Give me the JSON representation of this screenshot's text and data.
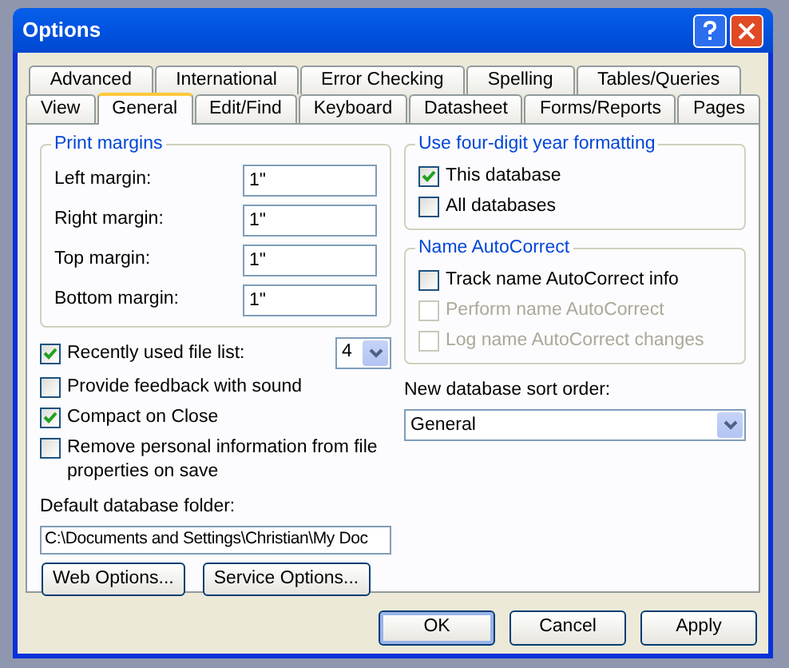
{
  "window": {
    "title": "Options"
  },
  "tab_rows": [
    [
      {
        "label": "Advanced",
        "selected": false
      },
      {
        "label": "International",
        "selected": false
      },
      {
        "label": "Error Checking",
        "selected": false
      },
      {
        "label": "Spelling",
        "selected": false
      },
      {
        "label": "Tables/Queries",
        "selected": false
      }
    ],
    [
      {
        "label": "View",
        "selected": false
      },
      {
        "label": "General",
        "selected": true
      },
      {
        "label": "Edit/Find",
        "selected": false
      },
      {
        "label": "Keyboard",
        "selected": false
      },
      {
        "label": "Datasheet",
        "selected": false
      },
      {
        "label": "Forms/Reports",
        "selected": false
      },
      {
        "label": "Pages",
        "selected": false
      }
    ]
  ],
  "print_margins": {
    "title": "Print margins",
    "fields": [
      {
        "label": "Left margin:",
        "value": "1\""
      },
      {
        "label": "Right margin:",
        "value": "1\""
      },
      {
        "label": "Top margin:",
        "value": "1\""
      },
      {
        "label": "Bottom margin:",
        "value": "1\""
      }
    ]
  },
  "options": [
    {
      "kind": "dropdown",
      "label": "Recently used file list:",
      "checked": true,
      "value": "4"
    },
    {
      "kind": "plain",
      "label": "Provide feedback with sound",
      "checked": false
    },
    {
      "kind": "plain",
      "label": "Compact on Close",
      "checked": true
    },
    {
      "kind": "plain",
      "label": "Remove personal information from file properties on save",
      "checked": false
    }
  ],
  "default_folder": {
    "label": "Default database folder:",
    "value": "C:\\Documents and Settings\\Christian\\My Doc"
  },
  "panel_buttons": [
    "Web Options...",
    "Service Options..."
  ],
  "year_formatting": {
    "title": "Use four-digit year formatting",
    "options": [
      {
        "label": "This database",
        "checked": true,
        "disabled": false
      },
      {
        "label": "All databases",
        "checked": false,
        "disabled": false
      }
    ]
  },
  "name_autocorrect": {
    "title": "Name AutoCorrect",
    "options": [
      {
        "label": "Track name AutoCorrect info",
        "checked": false,
        "disabled": false
      },
      {
        "label": "Perform name AutoCorrect",
        "checked": false,
        "disabled": true
      },
      {
        "label": "Log name AutoCorrect changes",
        "checked": false,
        "disabled": true
      }
    ]
  },
  "sort_order": {
    "label": "New database sort order:",
    "value": "General"
  },
  "dialog_buttons": [
    {
      "label": "OK",
      "focused": true
    },
    {
      "label": "Cancel",
      "focused": false
    },
    {
      "label": "Apply",
      "focused": false
    }
  ]
}
